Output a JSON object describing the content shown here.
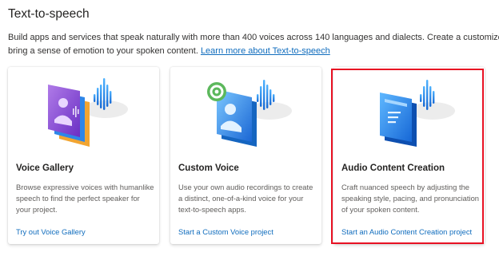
{
  "page": {
    "heading": "Text-to-speech",
    "description_line1": "Build apps and services that speak naturally with more than 400 voices across 140 languages and dialects. Create a customized voice to d",
    "description_line2_prefix": "bring a sense of emotion to your spoken content. ",
    "learn_more_link": "Learn more about Text-to-speech"
  },
  "cards": [
    {
      "title": "Voice Gallery",
      "body": "Browse expressive voices with humanlike speech to find the perfect speaker for your project.",
      "link": "Try out Voice Gallery",
      "illustration": "voice-gallery-illustration"
    },
    {
      "title": "Custom Voice",
      "body": "Use your own audio recordings to create a distinct, one-of-a-kind voice for your text-to-speech apps.",
      "link": "Start a Custom Voice project",
      "illustration": "custom-voice-illustration"
    },
    {
      "title": "Audio Content Creation",
      "body": "Craft nuanced speech by adjusting the speaking style, pacing, and pronunciation of your spoken content.",
      "link": "Start an Audio Content Creation project",
      "illustration": "audio-content-creation-illustration"
    }
  ],
  "colors": {
    "link": "#0f6cbd",
    "highlight_border": "#e81123",
    "accent_blue": "#1f8ae8",
    "accent_purple": "#7f3fd1",
    "accent_orange": "#f2a531",
    "accent_green": "#5cb85c"
  }
}
